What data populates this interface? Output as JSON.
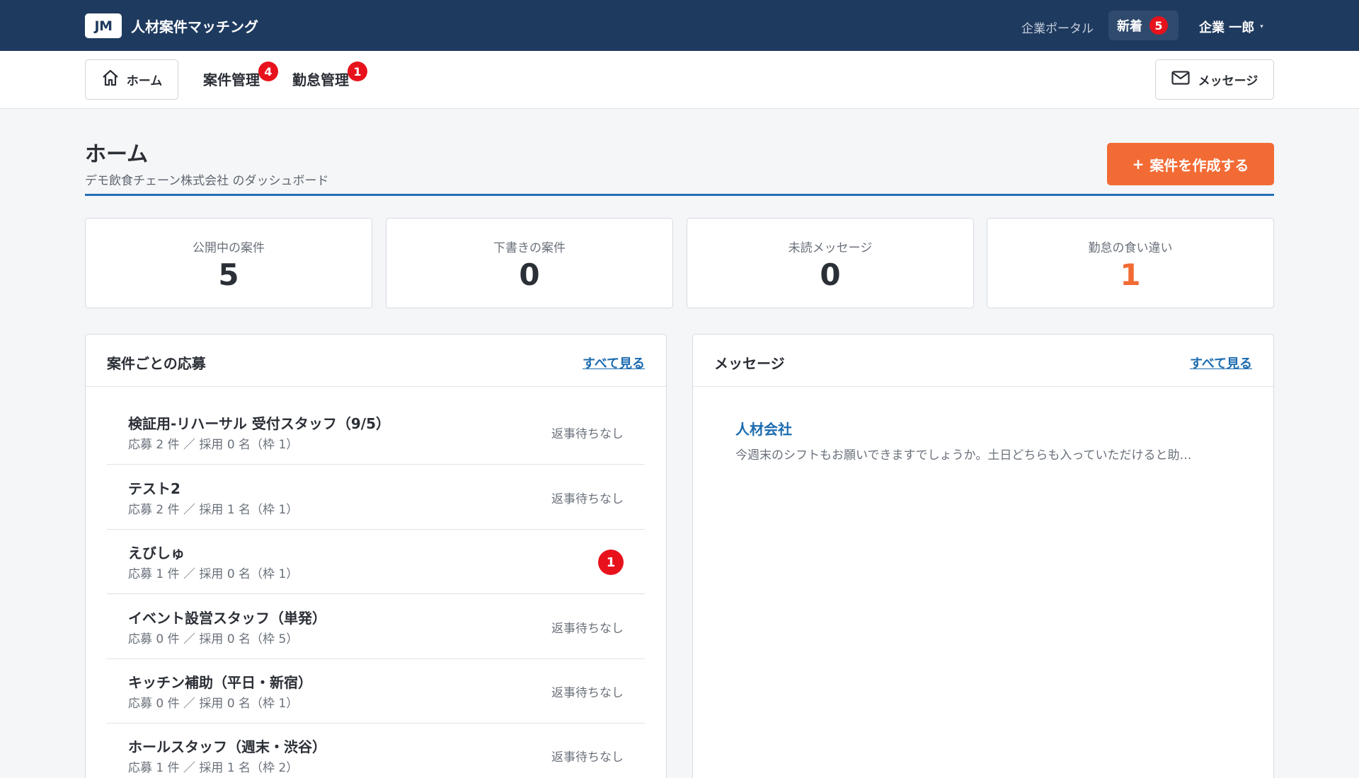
{
  "header": {
    "logo_text": "JM",
    "app_title": "人材案件マッチング",
    "portal_link": "企業ポータル",
    "new_label": "新着",
    "new_count": "5",
    "user_name": "企業 一郎",
    "user_caret": "▾"
  },
  "nav": {
    "home_label": "ホーム",
    "tabs": [
      {
        "label": "案件管理",
        "badge": "4"
      },
      {
        "label": "勤怠管理",
        "badge": "1"
      }
    ],
    "messages_label": "メッセージ"
  },
  "page": {
    "title": "ホーム",
    "subtitle": "デモ飲食チェーン株式会社 のダッシュボード",
    "create_button": "案件を作成する",
    "create_icon": "+"
  },
  "stats": [
    {
      "label": "公開中の案件",
      "value": "5"
    },
    {
      "label": "下書きの案件",
      "value": "0"
    },
    {
      "label": "未読メッセージ",
      "value": "0"
    },
    {
      "label": "勤怠の食い違い",
      "value": "1",
      "highlight_color": "#f26b35"
    }
  ],
  "applications": {
    "title": "案件ごとの応募",
    "see_all": "すべて見る",
    "rows": [
      {
        "title": "検証用-リハーサル 受付スタッフ（9/5）",
        "meta": "応募 2 件 ／ 採用 0 名（枠 1）",
        "status": "返事待ちなし"
      },
      {
        "title": "テスト2",
        "meta": "応募 2 件 ／ 採用 1 名（枠 1）",
        "status": "返事待ちなし"
      },
      {
        "title": "えびしゅ",
        "meta": "応募 1 件 ／ 採用 0 名（枠 1）",
        "badge": "1"
      },
      {
        "title": "イベント設営スタッフ（単発）",
        "meta": "応募 0 件 ／ 採用 0 名（枠 5）",
        "status": "返事待ちなし"
      },
      {
        "title": "キッチン補助（平日・新宿）",
        "meta": "応募 0 件 ／ 採用 0 名（枠 1）",
        "status": "返事待ちなし"
      },
      {
        "title": "ホールスタッフ（週末・渋谷）",
        "meta": "応募 1 件 ／ 採用 1 名（枠 2）",
        "status": "返事待ちなし"
      }
    ]
  },
  "messages": {
    "title": "メッセージ",
    "see_all": "すべて見る",
    "items": [
      {
        "sender": "人材会社",
        "preview": "今週末のシフトもお願いできますでしょうか。土日どちらも入っていただけると助…"
      }
    ]
  },
  "colors": {
    "header_bg": "#1e3a5f",
    "accent_orange": "#f26b35",
    "link_blue": "#1d6cb0",
    "badge_red": "#e8121c"
  }
}
